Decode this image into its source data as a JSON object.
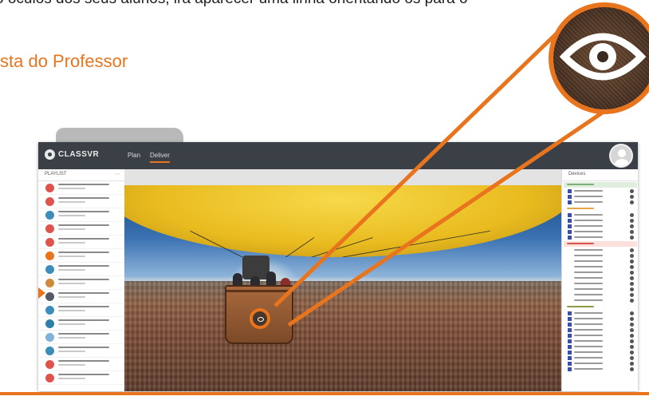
{
  "caption": "o óculos dos seus alunos, irá aparecer uma linha orientando os para o",
  "section_title": "sta do Professor",
  "app": {
    "logo_text": "CLASSVR",
    "nav": [
      "Plan",
      "Deliver"
    ],
    "active_nav": "Deliver"
  },
  "playlist": {
    "title": "PLAYLIST",
    "items": [
      {
        "color": "#e0534d"
      },
      {
        "color": "#e0534d"
      },
      {
        "color": "#3c8dbc"
      },
      {
        "color": "#e0534d"
      },
      {
        "color": "#e0534d"
      },
      {
        "color": "#e8741e"
      },
      {
        "color": "#3c8dbc"
      },
      {
        "color": "#d08a3c"
      },
      {
        "color": "#555b66"
      },
      {
        "color": "#3c8dbc"
      },
      {
        "color": "#2f7fa8"
      },
      {
        "color": "#7fb2d9"
      },
      {
        "color": "#3c8dbc"
      },
      {
        "color": "#e0534d"
      },
      {
        "color": "#e0534d"
      }
    ]
  },
  "devices": {
    "title": "Devices"
  },
  "colors": {
    "accent": "#e8741e",
    "topbar": "#3b4046"
  }
}
